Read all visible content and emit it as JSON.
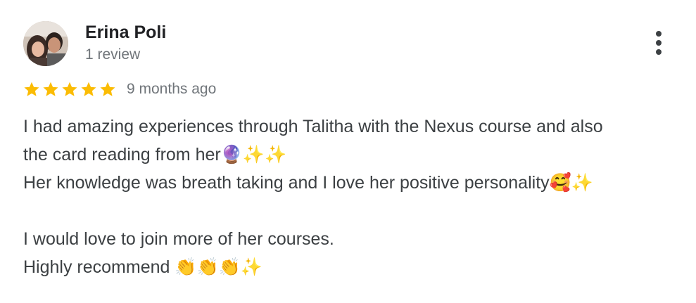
{
  "reviewer": {
    "name": "Erina Poli",
    "review_count": "1 review"
  },
  "rating": {
    "stars": 5,
    "max_stars": 5,
    "time": "9 months ago",
    "star_color": "#fbbc04"
  },
  "review": {
    "lines": [
      "I had amazing experiences through Talitha with the Nexus course and also",
      "the card reading from her🔮✨✨",
      "Her knowledge was breath taking and I love her positive personality🥰✨",
      "",
      "I would love to join more of her courses.",
      "Highly recommend 👏👏👏✨"
    ]
  },
  "icons": {
    "more": "more-vert-icon",
    "star": "star-icon"
  }
}
